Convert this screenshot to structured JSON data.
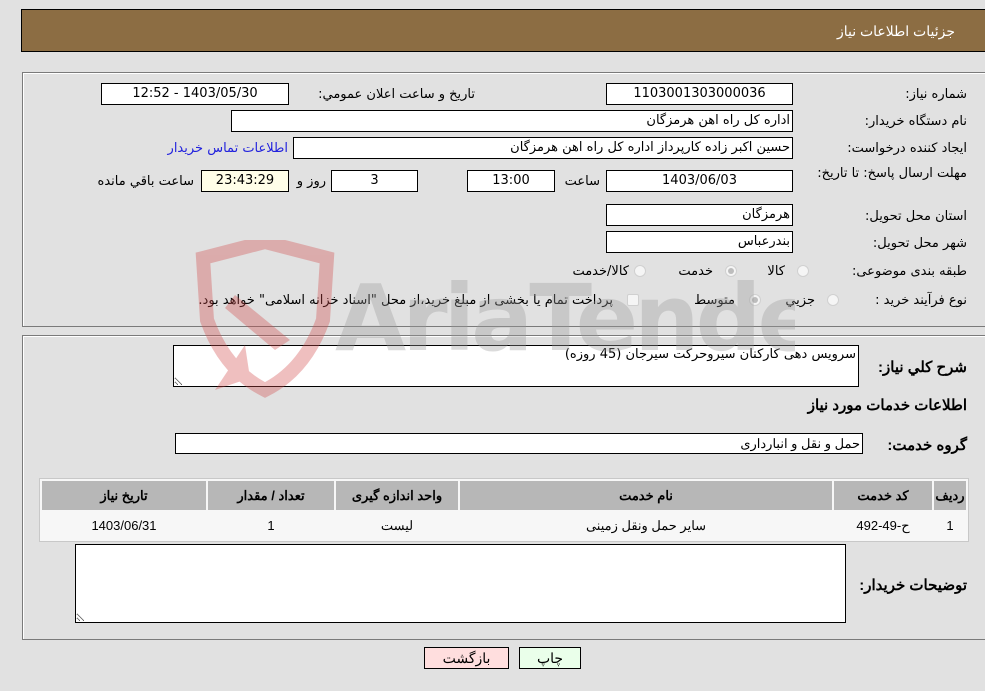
{
  "header": {
    "title": "جزئیات اطلاعات نیاز"
  },
  "info": {
    "need_number_label": "شماره نیاز:",
    "need_number": "1103001303000036",
    "announce_label": "تاریخ و ساعت اعلان عمومي:",
    "announce_value": "1403/05/30 - 12:52",
    "buyer_org_label": "نام دستگاه خریدار:",
    "buyer_org": "اداره کل راه اهن هرمزگان",
    "creator_label": "ایجاد کننده درخواست:",
    "creator": "حسین اکبر زاده  کارپرداز اداره کل راه اهن هرمزگان",
    "contact_link": "اطلاعات تماس خریدار",
    "deadline_label": "مهلت ارسال پاسخ: تا تاریخ:",
    "deadline_date": "1403/06/03",
    "time_label": "ساعت",
    "deadline_time": "13:00",
    "days_value": "3",
    "days_label": "روز و",
    "remaining_time": "23:43:29",
    "remaining_label": "ساعت باقي مانده",
    "province_label": "استان محل تحویل:",
    "province": "هرمزگان",
    "city_label": "شهر محل تحویل:",
    "city": "بندرعباس",
    "category_label": "طبقه بندی موضوعی:",
    "category_options": [
      {
        "label": "کالا",
        "selected": false
      },
      {
        "label": "خدمت",
        "selected": true
      },
      {
        "label": "کالا/خدمت",
        "selected": false
      }
    ],
    "process_label": "نوع فرآیند خرید :",
    "process_options": [
      {
        "label": "جزيي",
        "selected": false
      },
      {
        "label": "متوسط",
        "selected": true
      }
    ],
    "treasury_note": "پرداخت تمام یا بخشی از مبلغ خرید،از محل \"اسناد خزانه اسلامی\" خواهد بود."
  },
  "details": {
    "summary_label": "شرح كلي نياز:",
    "summary": "سرویس دهی کارکنان سیروحرکت سیرجان (45 روزه)",
    "services_heading": "اطلاعات خدمات مورد نیاز",
    "service_group_label": "گروه خدمت:",
    "service_group": "حمل و نقل و انبارداری",
    "table": {
      "headers": [
        "ردیف",
        "کد خدمت",
        "نام خدمت",
        "واحد اندازه گیری",
        "تعداد / مقدار",
        "تاریخ نیاز"
      ],
      "rows": [
        [
          "1",
          "ح-49-492",
          "سایر حمل ونقل زمینی",
          "لیست",
          "1",
          "1403/06/31"
        ]
      ]
    },
    "buyer_notes_label": "توضیحات خریدار:",
    "buyer_notes": ""
  },
  "buttons": {
    "print": "چاپ",
    "back": "بازگشت"
  },
  "watermark": {
    "text": "AriaTender.neT"
  },
  "colors": {
    "header_bg": "#8c6d43",
    "print_bg": "#eaffea",
    "back_bg": "#ffdede",
    "link": "#2222dd"
  }
}
